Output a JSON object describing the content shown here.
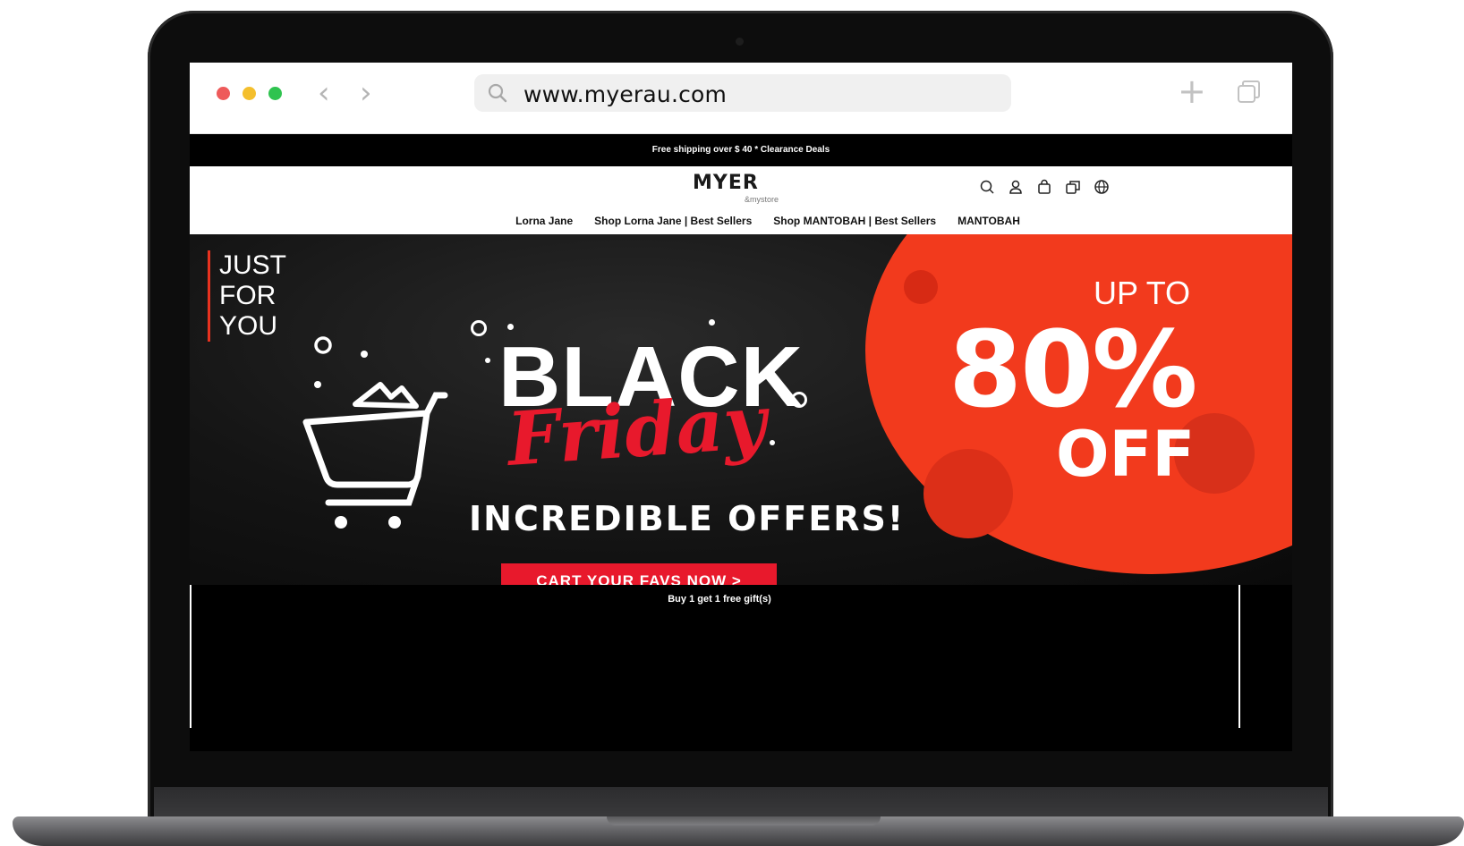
{
  "browser": {
    "url": "www.myerau.com"
  },
  "site": {
    "promo_bar": "Free shipping over $ 40 * Clearance Deals",
    "logo": {
      "main": "MYER",
      "sub": "&mystore"
    },
    "header_icons": [
      "search-icon",
      "user-icon",
      "bag-icon",
      "compare-icon",
      "globe-icon"
    ],
    "nav": {
      "items": [
        {
          "label": "Lorna Jane"
        },
        {
          "label": "Shop Lorna Jane | Best Sellers"
        },
        {
          "label": "Shop MANTOBAH | Best Sellers"
        },
        {
          "label": "MANTOBAH"
        }
      ]
    },
    "banner": {
      "just_for_you": [
        "JUST",
        "FOR",
        "YOU"
      ],
      "title_black": "BLACK",
      "title_friday": "Friday",
      "subtitle": "INCREDIBLE OFFERS!",
      "cta": "CART YOUR FAVS NOW >",
      "up_to": "UP TO",
      "percent": "80%",
      "off": "OFF",
      "colors": {
        "accent_red": "#e8192c",
        "circle_orange": "#f23a1d"
      }
    },
    "gift_text": "Buy 1 get 1 free gift(s)"
  }
}
